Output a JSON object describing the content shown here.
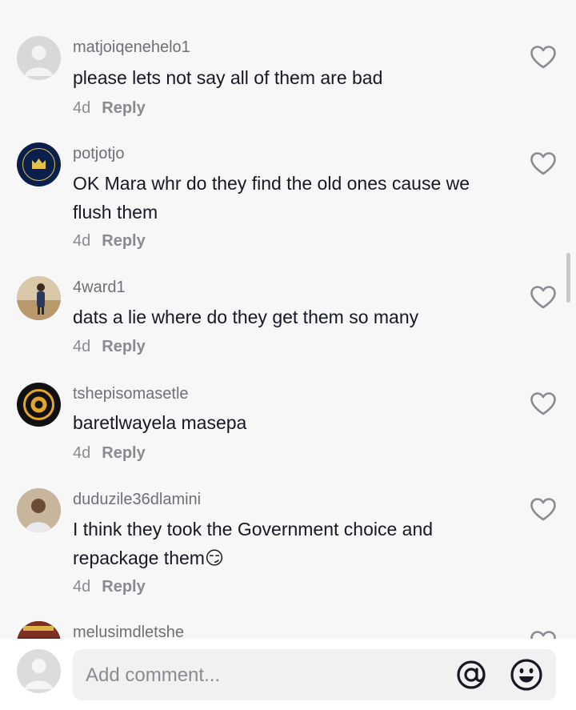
{
  "comments": [
    {
      "username": "matjoiqenehelo1",
      "text": "please lets not say all of them are bad",
      "age": "4d",
      "reply_label": "Reply"
    },
    {
      "username": "potjotjo",
      "text": "OK Mara whr do they find the old ones cause we flush them",
      "age": "4d",
      "reply_label": "Reply"
    },
    {
      "username": "4ward1",
      "text": "dats a lie where do they get them so many",
      "age": "4d",
      "reply_label": "Reply"
    },
    {
      "username": "tshepisomasetle",
      "text": "baretlwayela masepa",
      "age": "4d",
      "reply_label": "Reply"
    },
    {
      "username": "duduzile36dlamini",
      "text": "I think they took the Government choice and repackage them",
      "emoji": "😏",
      "age": "4d",
      "reply_label": "Reply"
    },
    {
      "username": "melusimdletshe"
    }
  ],
  "composer": {
    "placeholder": "Add comment...",
    "mention_icon": "at-icon",
    "emoji_icon": "emoji-icon"
  },
  "colors": {
    "background": "#f7f7f7",
    "username": "#6f7077",
    "meta": "#8a8b91",
    "text": "#161823"
  }
}
